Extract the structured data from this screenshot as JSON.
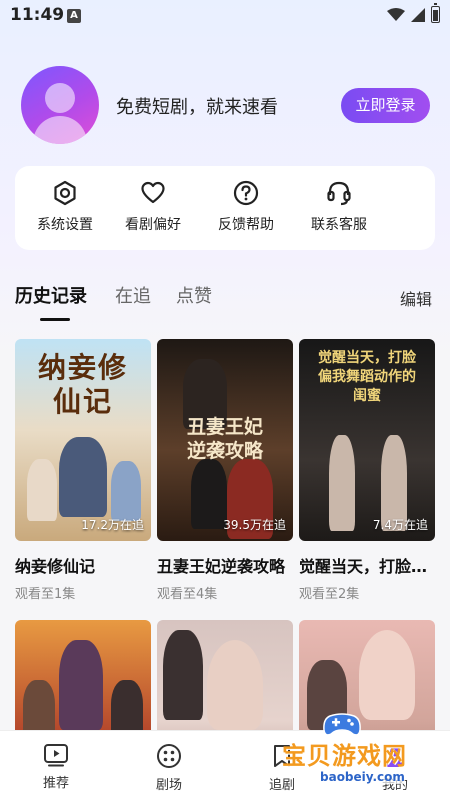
{
  "status_bar": {
    "time": "11:49",
    "notification_icon": "A"
  },
  "profile": {
    "tagline": "免费短剧，就来速看",
    "login_label": "立即登录"
  },
  "actions": [
    {
      "icon": "gear-icon",
      "label": "系统设置"
    },
    {
      "icon": "heart-icon",
      "label": "看剧偏好"
    },
    {
      "icon": "question-icon",
      "label": "反馈帮助"
    },
    {
      "icon": "headset-icon",
      "label": "联系客服"
    }
  ],
  "tabs": {
    "history": "历史记录",
    "following": "在追",
    "likes": "点赞",
    "edit": "编辑"
  },
  "cards": [
    {
      "poster_title": "纳妾修仙记",
      "followers": "17.2万在追",
      "title": "纳妾修仙记",
      "progress": "观看至1集"
    },
    {
      "poster_title": "丑妻王妃逆袭攻略",
      "followers": "39.5万在追",
      "title": "丑妻王妃逆袭攻略",
      "progress": "观看至4集"
    },
    {
      "poster_title": "觉醒当天，打脸偏我舞蹈动作的闺蜜",
      "followers": "7.4万在追",
      "title": "觉醒当天，打脸偏我舞蹈动作的闺蜜",
      "progress": "观看至2集"
    }
  ],
  "bottom_nav": [
    {
      "icon": "play-icon",
      "label": "推荐"
    },
    {
      "icon": "grid-icon",
      "label": "剧场"
    },
    {
      "icon": "bookmark-icon",
      "label": "追剧"
    },
    {
      "icon": "user-icon",
      "label": "我的"
    }
  ],
  "watermark": {
    "text": "宝贝游戏网",
    "url": "baobeiy.com"
  },
  "colors": {
    "accent": "#8a4ef2",
    "background": "#f6f6f8"
  }
}
